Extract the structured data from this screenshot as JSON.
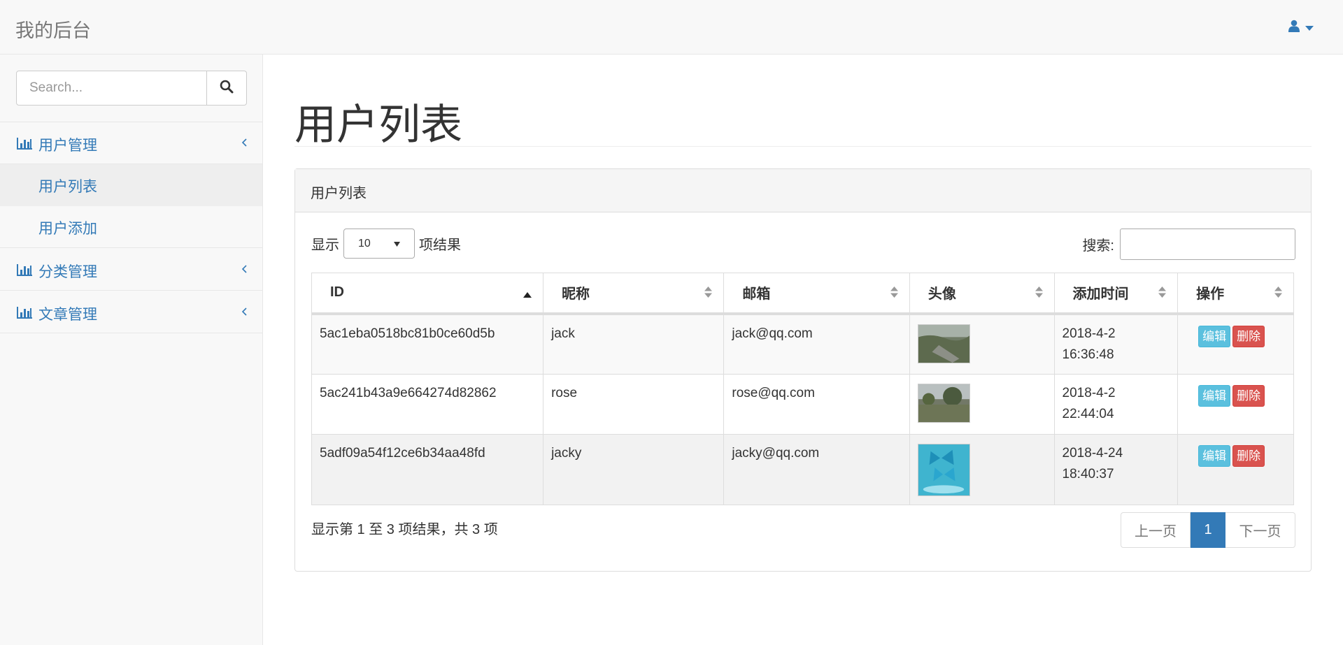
{
  "navbar": {
    "brand": "我的后台"
  },
  "sidebar": {
    "search_placeholder": "Search...",
    "groups": [
      {
        "label": "用户管理",
        "items": [
          {
            "label": "用户列表",
            "active": true
          },
          {
            "label": "用户添加"
          }
        ]
      },
      {
        "label": "分类管理"
      },
      {
        "label": "文章管理"
      }
    ]
  },
  "main": {
    "page_title": "用户列表",
    "panel_title": "用户列表",
    "length": {
      "prefix": "显示",
      "value": "10",
      "suffix": "项结果"
    },
    "filter_label": "搜索:",
    "columns": [
      "ID",
      "昵称",
      "邮箱",
      "头像",
      "添加时间",
      "操作"
    ],
    "rows": [
      {
        "id": "5ac1eba0518bc81b0ce60d5b",
        "nickname": "jack",
        "email": "jack@qq.com",
        "date": "2018-4-2",
        "time": "16:36:48"
      },
      {
        "id": "5ac241b43a9e664274d82862",
        "nickname": "rose",
        "email": "rose@qq.com",
        "date": "2018-4-2",
        "time": "22:44:04"
      },
      {
        "id": "5adf09a54f12ce6b34aa48fd",
        "nickname": "jacky",
        "email": "jacky@qq.com",
        "date": "2018-4-24",
        "time": "18:40:37"
      }
    ],
    "actions": {
      "edit": "编辑",
      "delete": "删除"
    },
    "info": "显示第 1 至 3 项结果，共 3 项",
    "pagination": {
      "prev": "上一页",
      "current": "1",
      "next": "下一页"
    }
  },
  "colors": {
    "link": "#337ab7",
    "info": "#5bc0de",
    "danger": "#d9534f"
  }
}
